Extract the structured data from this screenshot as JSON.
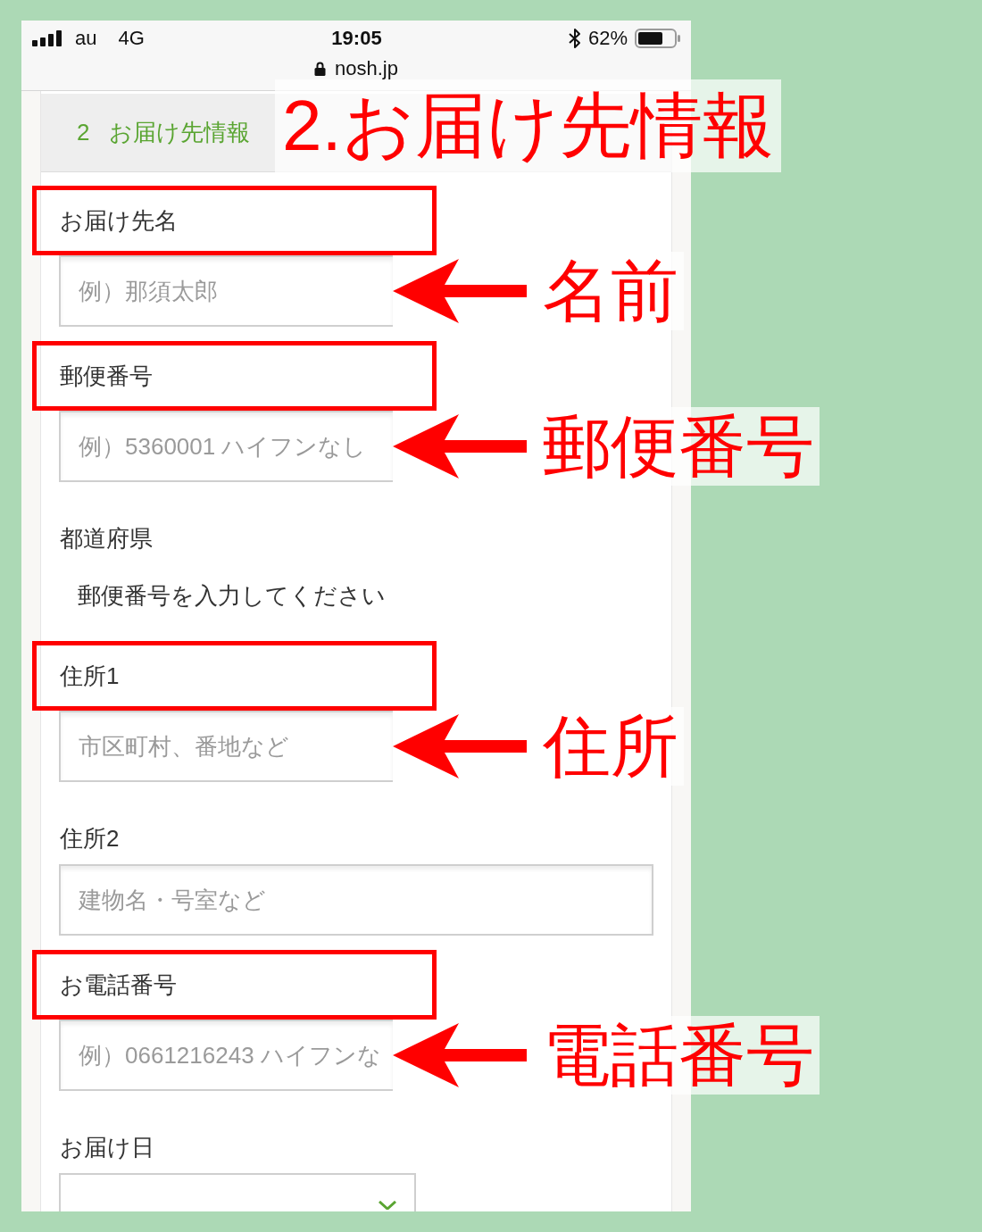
{
  "status_bar": {
    "carrier": "au",
    "network": "4G",
    "time": "19:05",
    "battery": "62%",
    "url": "nosh.jp"
  },
  "section": {
    "number": "2",
    "title": "お届け先情報",
    "annotation": "2.お届け先情報"
  },
  "fields": [
    {
      "kind": "input",
      "label": "お届け先名",
      "highlighted": true,
      "placeholder": "例）那須太郎",
      "annotation": "名前"
    },
    {
      "kind": "input",
      "label": "郵便番号",
      "highlighted": true,
      "placeholder": "例）5360001 ハイフンなし",
      "annotation": "郵便番号"
    },
    {
      "kind": "text",
      "label": "都道府県",
      "highlighted": false,
      "value": "郵便番号を入力してください"
    },
    {
      "kind": "input",
      "label": "住所1",
      "highlighted": true,
      "placeholder": "市区町村、番地など",
      "annotation": "住所"
    },
    {
      "kind": "input",
      "label": "住所2",
      "highlighted": false,
      "placeholder": "建物名・号室など"
    },
    {
      "kind": "input",
      "label": "お電話番号",
      "highlighted": true,
      "placeholder": "例）0661216243 ハイフンな",
      "annotation": "電話番号"
    },
    {
      "kind": "select",
      "label": "お届け日",
      "highlighted": false
    }
  ]
}
